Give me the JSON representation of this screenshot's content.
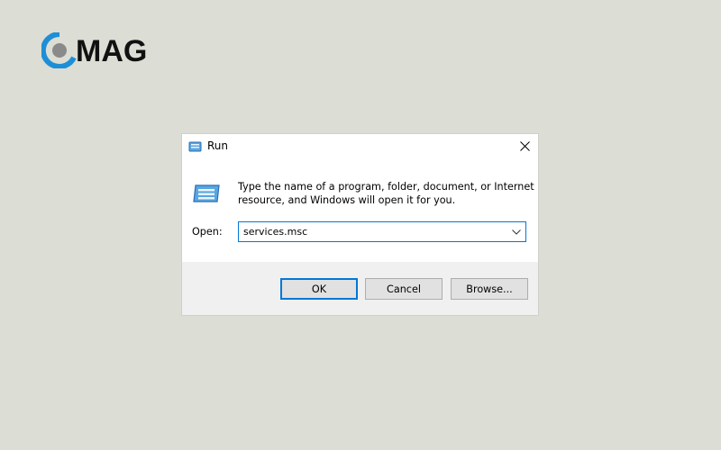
{
  "logo": {
    "text": "MAG",
    "colors": {
      "ring": "#1e8fd6",
      "dot": "#8a8a8a",
      "text": "#111111"
    }
  },
  "dialog": {
    "title": "Run",
    "description_line1": "Type the name of a program, folder, document, or Internet",
    "description_line2": "resource, and Windows will open it for you.",
    "open_label": "Open:",
    "open_value": "services.msc",
    "buttons": {
      "ok": "OK",
      "cancel": "Cancel",
      "browse": "Browse..."
    },
    "icons": [
      "run-icon",
      "close-icon",
      "chevron-down-icon"
    ],
    "accent": "#0078d7"
  }
}
